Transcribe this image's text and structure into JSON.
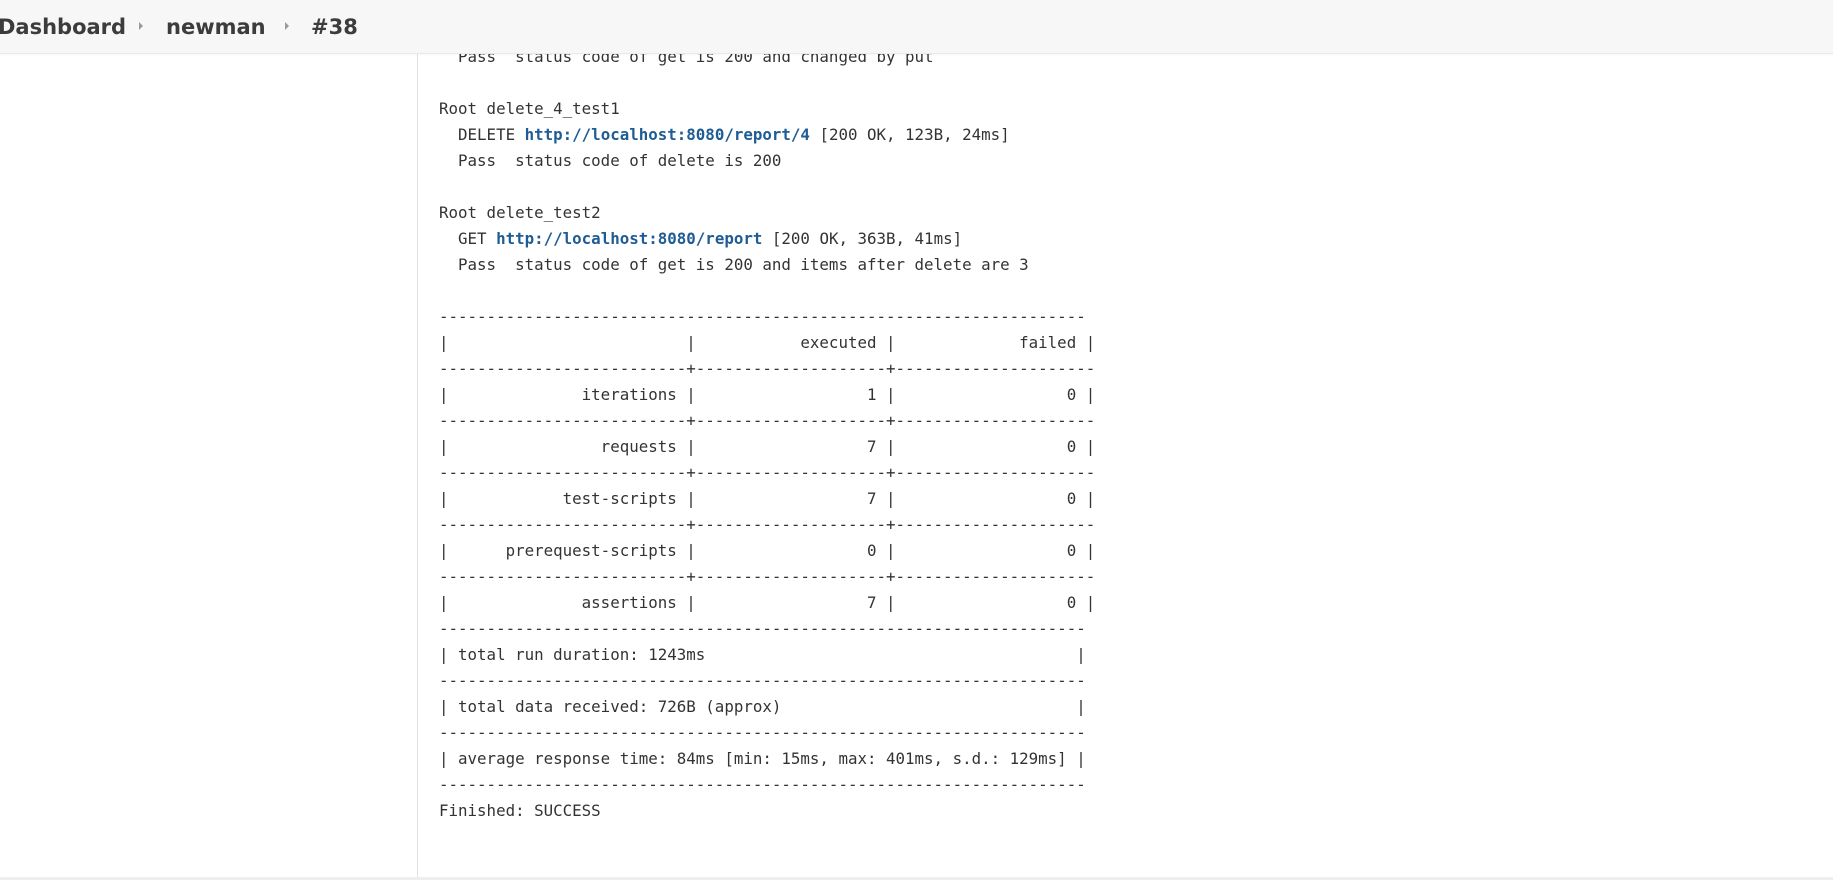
{
  "breadcrumb": {
    "items": [
      "Dashboard",
      "newman",
      "#38"
    ]
  },
  "console": {
    "lines": [
      "  Pass  status code of get is 200 and changed by put",
      "",
      "Root delete_4_test1",
      [
        {
          "t": "  DELETE "
        },
        {
          "link": "http://localhost:8080/report/4"
        },
        {
          "t": " [200 OK, 123B, 24ms]"
        }
      ],
      "  Pass  status code of delete is 200",
      "",
      "Root delete_test2",
      [
        {
          "t": "  GET "
        },
        {
          "link": "http://localhost:8080/report"
        },
        {
          "t": " [200 OK, 363B, 41ms]"
        }
      ],
      "  Pass  status code of get is 200 and items after delete are 3",
      "",
      "--------------------------------------------------------------------",
      "|                         |           executed |             failed |",
      "--------------------------+--------------------+---------------------",
      "|              iterations |                  1 |                  0 |",
      "--------------------------+--------------------+---------------------",
      "|                requests |                  7 |                  0 |",
      "--------------------------+--------------------+---------------------",
      "|            test-scripts |                  7 |                  0 |",
      "--------------------------+--------------------+---------------------",
      "|      prerequest-scripts |                  0 |                  0 |",
      "--------------------------+--------------------+---------------------",
      "|              assertions |                  7 |                  0 |",
      "--------------------------------------------------------------------",
      "| total run duration: 1243ms                                       |",
      "--------------------------------------------------------------------",
      "| total data received: 726B (approx)                               |",
      "--------------------------------------------------------------------",
      "| average response time: 84ms [min: 15ms, max: 401ms, s.d.: 129ms] |",
      "--------------------------------------------------------------------",
      "Finished: SUCCESS"
    ]
  }
}
